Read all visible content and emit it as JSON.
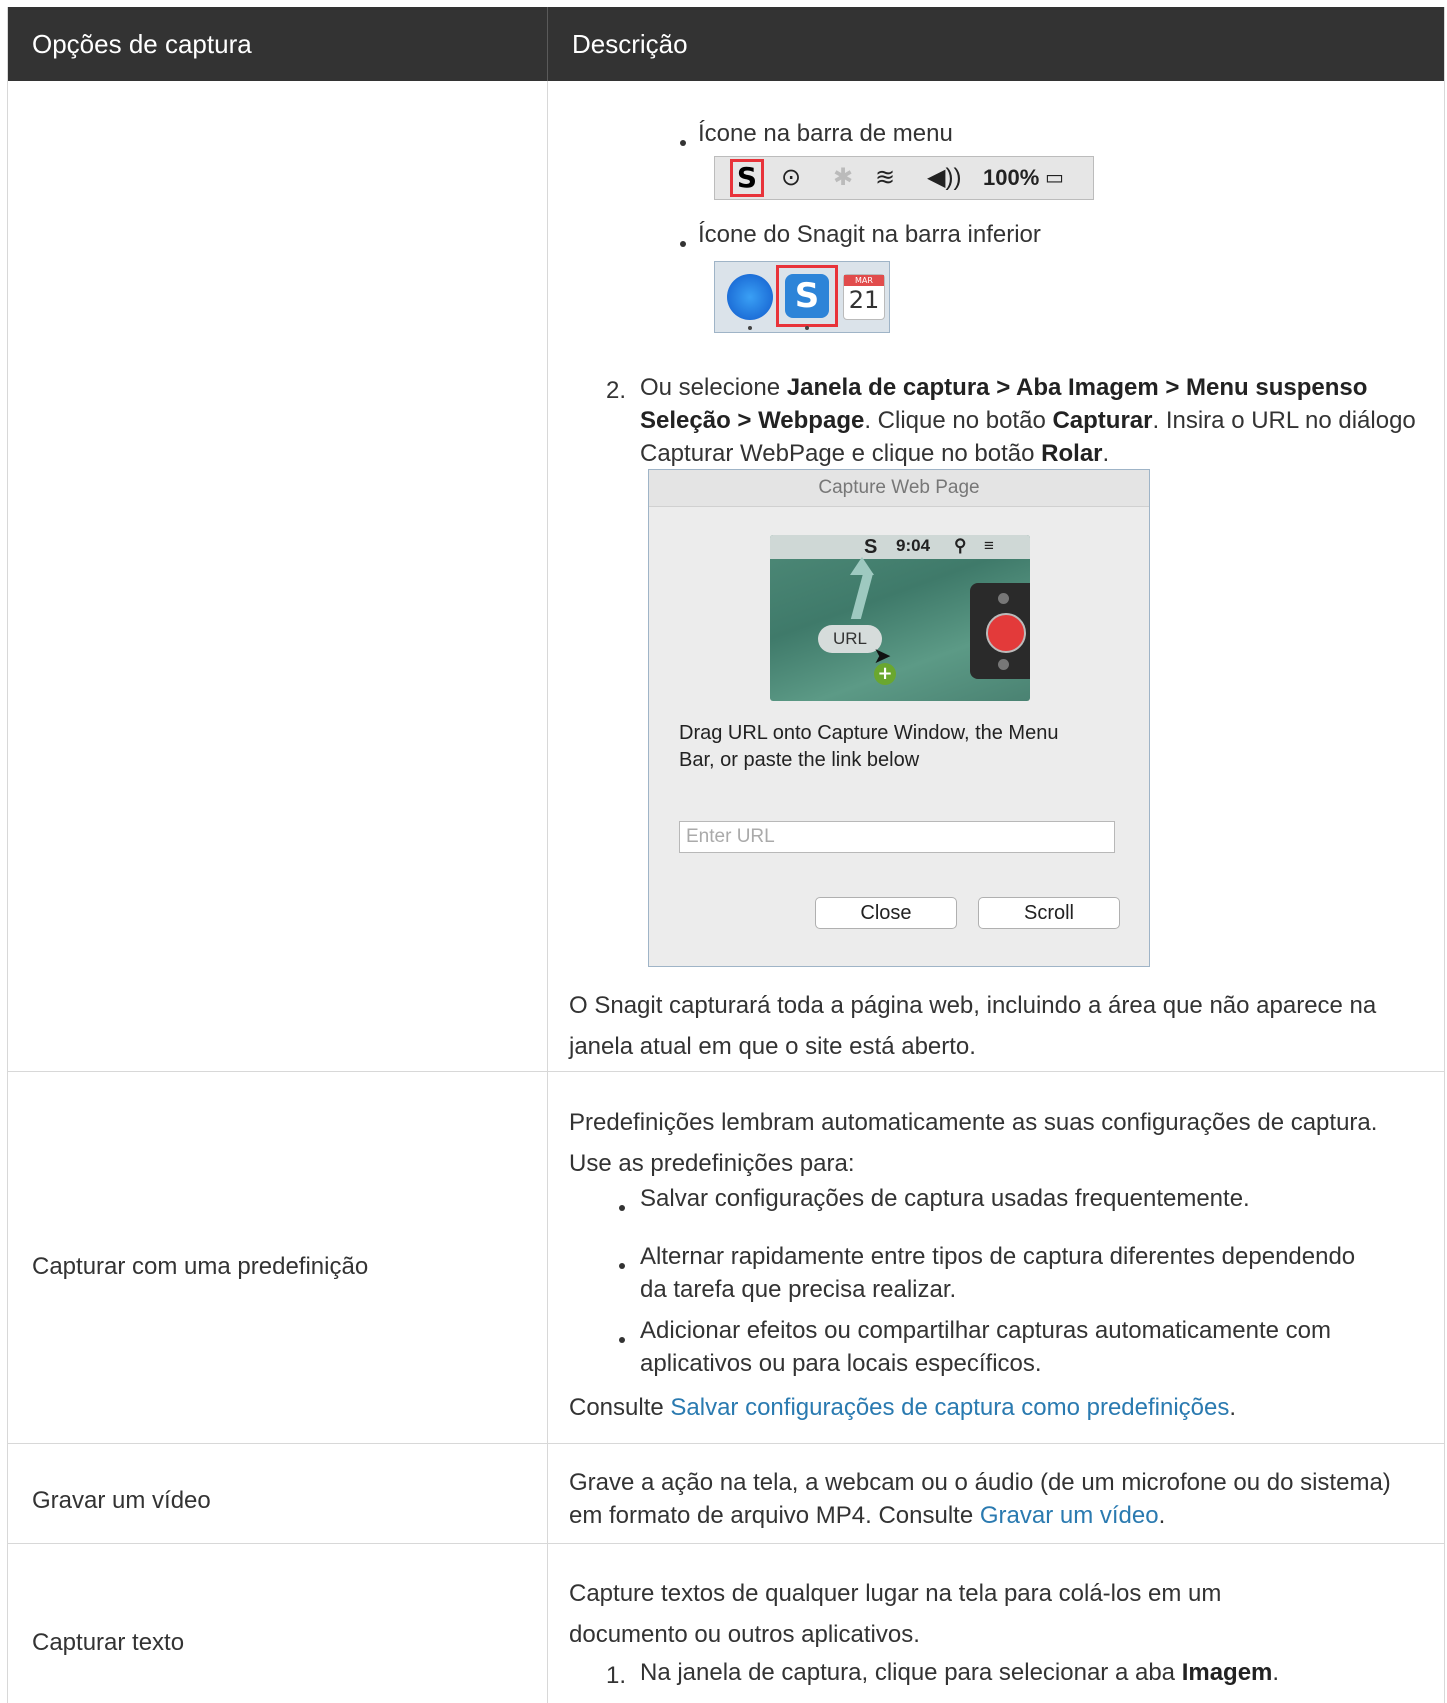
{
  "header": {
    "col1": "Opções de captura",
    "col2": "Descrição"
  },
  "row1": {
    "bullet1": "Ícone na barra de menu",
    "menubar_percent": "100%",
    "bullet2": "Ícone do Snagit na barra inferior",
    "dock_calendar_month": "MAR",
    "dock_calendar_day": "21",
    "step2_num": "2.",
    "step2_a": "Ou selecione ",
    "step2_b": "Janela de captura > Aba Imagem > Menu suspenso Seleção > Webpage",
    "step2_c": ". Clique no botão ",
    "step2_d": "Capturar",
    "step2_e": ". Insira o URL no diálogo Capturar WebPage e clique no botão ",
    "step2_f": "Rolar",
    "step2_g": ".",
    "dialog": {
      "title": "Capture Web Page",
      "clock": "9:04",
      "pill": "URL",
      "message": "Drag URL onto Capture Window, the Menu Bar, or paste the link below",
      "placeholder": "Enter URL",
      "close": "Close",
      "scroll": "Scroll"
    },
    "closing": "O Snagit capturará toda a página web, incluindo a área que não aparece na janela atual em que o site está aberto."
  },
  "row2": {
    "label": "Capturar com uma predefinição",
    "intro": "Predefinições lembram automaticamente as suas configurações de captura. Use as predefinições para:",
    "bullets": [
      "Salvar configurações de captura usadas frequentemente.",
      "Alternar rapidamente entre tipos de captura diferentes dependendo da tarefa que precisa realizar.",
      "Adicionar efeitos ou compartilhar capturas automaticamente com aplicativos ou para locais específicos."
    ],
    "see": "Consulte ",
    "link": "Salvar configurações de captura como predefinições",
    "end": "."
  },
  "row3": {
    "label": "Gravar um vídeo",
    "text": "Grave a ação na tela, a webcam ou o áudio (de um microfone ou do sistema) em formato de arquivo MP4. Consulte ",
    "link": "Gravar um vídeo",
    "end": "."
  },
  "row4": {
    "label": "Capturar texto",
    "intro": "Capture textos de qualquer lugar na tela para colá-los em um documento ou outros aplicativos.",
    "step1_num": "1.",
    "step1_a": "Na janela de captura, clique para selecionar a aba ",
    "step1_b": "Imagem",
    "step1_c": "."
  }
}
